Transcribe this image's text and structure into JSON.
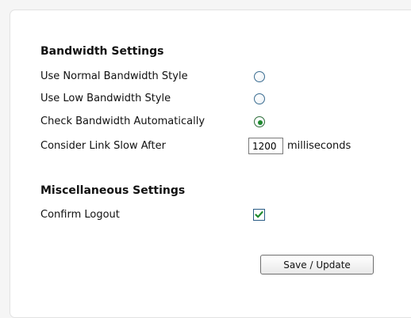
{
  "bandwidth": {
    "title": "Bandwidth Settings",
    "options": [
      {
        "label": "Use Normal Bandwidth Style",
        "selected": false
      },
      {
        "label": "Use Low Bandwidth Style",
        "selected": false
      },
      {
        "label": "Check Bandwidth Automatically",
        "selected": true
      }
    ],
    "slow_link": {
      "label": "Consider Link Slow After",
      "value": "1200",
      "unit": "milliseconds"
    }
  },
  "misc": {
    "title": "Miscellaneous Settings",
    "confirm_logout": {
      "label": "Confirm Logout",
      "checked": true
    }
  },
  "actions": {
    "save_label": "Save / Update"
  },
  "colors": {
    "accent_green": "#1f8a2e",
    "control_border": "#3c6e91"
  },
  "icons": {
    "check": "checkmark-icon"
  }
}
